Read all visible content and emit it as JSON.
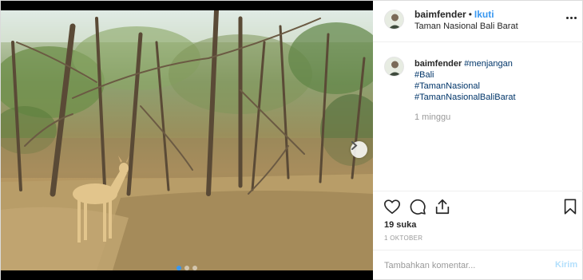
{
  "post": {
    "username": "baimfender",
    "separator": "•",
    "follow_label": "Ikuti",
    "location": "Taman Nasional Bali Barat",
    "caption_text": "#menjangan",
    "hashtags": [
      "#Bali",
      "#TamanNasional",
      "#TamanNasionalBaliBarat"
    ],
    "time_ago": "1 minggu",
    "likes_label": "19 suka",
    "date": "1 OKTOBER",
    "comment_placeholder": "Tambahkan komentar...",
    "post_label": "Kirim"
  },
  "carousel": {
    "slides": 3,
    "active_index": 0
  },
  "icons": {
    "more": "more-options-icon",
    "like": "heart-icon",
    "comment": "comment-bubble-icon",
    "share": "share-icon",
    "save": "bookmark-icon",
    "next": "chevron-right-icon"
  },
  "colors": {
    "link": "#3897f0",
    "hashtag": "#003569",
    "muted": "#999999",
    "post_button_disabled": "#b2dffc",
    "border": "#efefef"
  }
}
